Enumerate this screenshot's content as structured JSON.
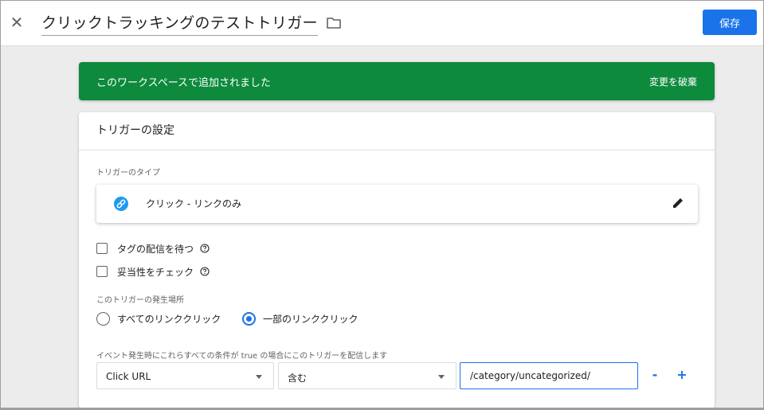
{
  "header": {
    "close_icon": "close-icon",
    "title": "クリックトラッキングのテストトリガー",
    "folder_icon": "folder-icon",
    "save_label": "保存"
  },
  "notice": {
    "message": "このワークスペースで追加されました",
    "discard_label": "変更を破棄",
    "color": "#0d8a3c"
  },
  "trigger_config": {
    "heading": "トリガーの設定",
    "type_label": "トリガーのタイプ",
    "type_value": "クリック - リンクのみ",
    "type_icon": "link-icon",
    "edit_icon": "pencil-icon",
    "checkboxes": [
      {
        "label": "タグの配信を待つ",
        "checked": false,
        "help_icon": "help-icon"
      },
      {
        "label": "妥当性をチェック",
        "checked": false,
        "help_icon": "help-icon"
      }
    ],
    "fire_on_label": "このトリガーの発生場所",
    "radio_options": [
      {
        "label": "すべてのリンククリック",
        "selected": false
      },
      {
        "label": "一部のリンククリック",
        "selected": true
      }
    ],
    "condition_label": "イベント発生時にこれらすべての条件が true の場合にこのトリガーを配信します",
    "condition": {
      "variable": "Click URL",
      "operator": "含む",
      "value": "/category/uncategorized/"
    },
    "remove_label": "-",
    "add_label": "+"
  },
  "colors": {
    "accent": "#1a73e8",
    "link_badge": "#1e9bf0"
  }
}
